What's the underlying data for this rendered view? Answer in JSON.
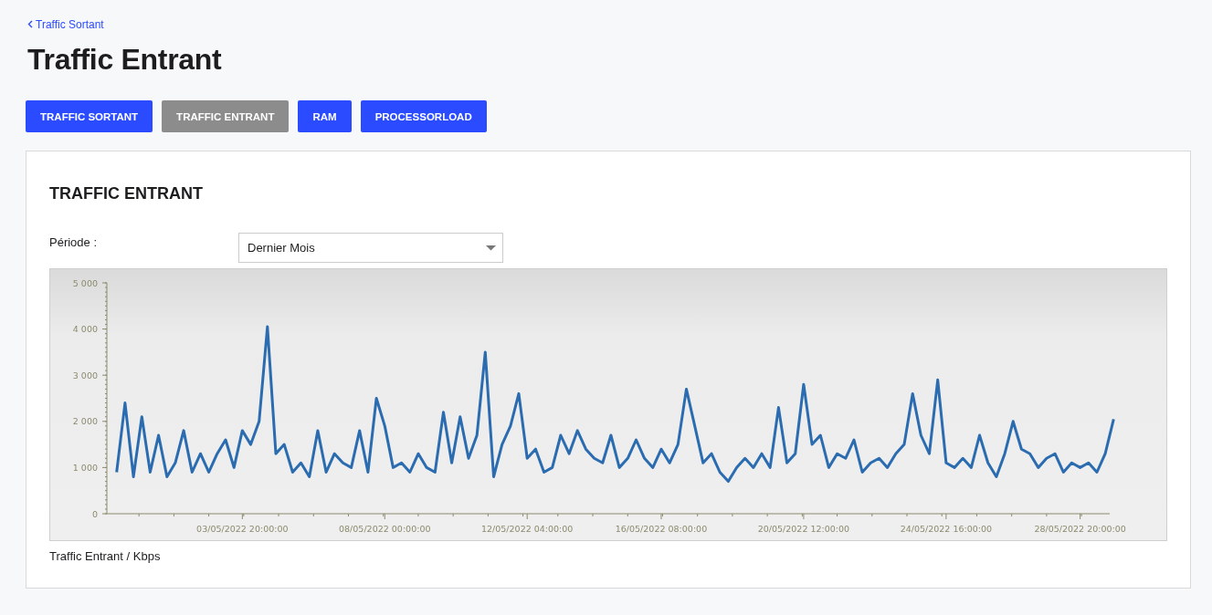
{
  "breadcrumb": {
    "label": "Traffic Sortant"
  },
  "page_title": "Traffic Entrant",
  "tabs": [
    {
      "label": "TRAFFIC SORTANT",
      "selected": false
    },
    {
      "label": "TRAFFIC ENTRANT",
      "selected": true
    },
    {
      "label": "RAM",
      "selected": false
    },
    {
      "label": "PROCESSORLOAD",
      "selected": false
    }
  ],
  "card": {
    "title": "TRAFFIC ENTRANT",
    "period": {
      "label": "Période :",
      "value": "Dernier Mois"
    },
    "chart_data": {
      "type": "line",
      "ylim": [
        0,
        5000
      ],
      "yticks": [
        {
          "value": 0,
          "label": "0"
        },
        {
          "value": 1000,
          "label": "1 000"
        },
        {
          "value": 2000,
          "label": "2 000"
        },
        {
          "value": 3000,
          "label": "3 000"
        },
        {
          "value": 4000,
          "label": "4 000"
        },
        {
          "value": 5000,
          "label": "5 000"
        }
      ],
      "categories": [
        null,
        null,
        null,
        null,
        null,
        null,
        null,
        null,
        null,
        null,
        null,
        null,
        null,
        null,
        null,
        "03/05/2022 20:00:00",
        null,
        null,
        null,
        null,
        null,
        null,
        null,
        null,
        null,
        null,
        null,
        null,
        null,
        null,
        null,
        null,
        "08/05/2022 00:00:00",
        null,
        null,
        null,
        null,
        null,
        null,
        null,
        null,
        null,
        null,
        null,
        null,
        null,
        null,
        null,
        null,
        "12/05/2022 04:00:00",
        null,
        null,
        null,
        null,
        null,
        null,
        null,
        null,
        null,
        null,
        null,
        null,
        null,
        null,
        null,
        "16/05/2022 08:00:00",
        null,
        null,
        null,
        null,
        null,
        null,
        null,
        null,
        null,
        null,
        null,
        null,
        null,
        null,
        null,
        null,
        "20/05/2022 12:00:00",
        null,
        null,
        null,
        null,
        null,
        null,
        null,
        null,
        null,
        null,
        null,
        null,
        null,
        null,
        null,
        null,
        "24/05/2022 16:00:00",
        null,
        null,
        null,
        null,
        null,
        null,
        null,
        null,
        null,
        null,
        null,
        null,
        null,
        null,
        null,
        "28/05/2022 20:00:00",
        null,
        null,
        null,
        null
      ],
      "series": [
        {
          "color": "#2b6cb0",
          "values": [
            900,
            2400,
            800,
            2100,
            900,
            1700,
            800,
            1100,
            1800,
            900,
            1300,
            900,
            1300,
            1600,
            1000,
            1800,
            1500,
            2000,
            4050,
            1300,
            1500,
            900,
            1100,
            800,
            1800,
            900,
            1300,
            1100,
            1000,
            1800,
            900,
            2500,
            1900,
            1000,
            1100,
            900,
            1300,
            1000,
            900,
            2200,
            1100,
            2100,
            1200,
            1700,
            3500,
            800,
            1500,
            1900,
            2600,
            1200,
            1400,
            900,
            1000,
            1700,
            1300,
            1800,
            1400,
            1200,
            1100,
            1700,
            1000,
            1200,
            1600,
            1200,
            1000,
            1400,
            1100,
            1500,
            2700,
            1900,
            1100,
            1300,
            900,
            700,
            1000,
            1200,
            1000,
            1300,
            1000,
            2300,
            1100,
            1300,
            2800,
            1500,
            1700,
            1000,
            1300,
            1200,
            1600,
            900,
            1100,
            1200,
            1000,
            1300,
            1500,
            2600,
            1700,
            1300,
            2900,
            1100,
            1000,
            1200,
            1000,
            1700,
            1100,
            800,
            1300,
            2000,
            1400,
            1300,
            1000,
            1200,
            1300,
            900,
            1100,
            1000,
            1100,
            900,
            1300,
            2050
          ]
        }
      ]
    },
    "caption": "Traffic Entrant / Kbps"
  }
}
